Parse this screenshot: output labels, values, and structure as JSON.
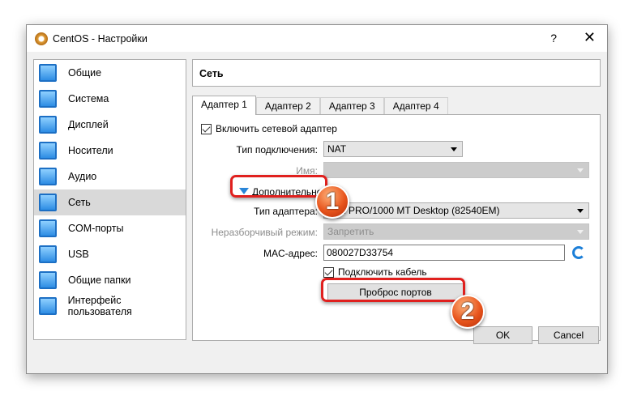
{
  "window": {
    "title": "CentOS - Настройки",
    "help": "?",
    "close": "✕"
  },
  "sidebar": {
    "items": [
      {
        "label": "Общие",
        "icon": "general-icon"
      },
      {
        "label": "Система",
        "icon": "system-icon"
      },
      {
        "label": "Дисплей",
        "icon": "display-icon"
      },
      {
        "label": "Носители",
        "icon": "storage-icon"
      },
      {
        "label": "Аудио",
        "icon": "audio-icon"
      },
      {
        "label": "Сеть",
        "icon": "network-icon"
      },
      {
        "label": "COM-порты",
        "icon": "serial-ports-icon"
      },
      {
        "label": "USB",
        "icon": "usb-icon"
      },
      {
        "label": "Общие папки",
        "icon": "shared-folders-icon"
      },
      {
        "label": "Интерфейс пользователя",
        "icon": "user-interface-icon"
      }
    ],
    "active": "Сеть"
  },
  "header": {
    "title": "Сеть"
  },
  "tabs": [
    "Адаптер 1",
    "Адаптер 2",
    "Адаптер 3",
    "Адаптер 4"
  ],
  "form": {
    "enable_adapter": "Включить сетевой адаптер",
    "attached_to_label": "Тип подключения:",
    "attached_to_value": "NAT",
    "name_label": "Имя:",
    "advanced": "Дополнительно",
    "adapter_type_label": "Тип адаптера:",
    "adapter_type_value": "Intel PRO/1000 MT Desktop (82540EM)",
    "promisc_label": "Неразборчивый режим:",
    "promisc_value": "Запретить",
    "mac_label": "MAC-адрес:",
    "mac_value": "080027D33754",
    "cable": "Подключить кабель",
    "port_forwarding": "Проброс портов"
  },
  "buttons": {
    "ok": "OK",
    "cancel": "Cancel"
  },
  "annotations": {
    "step1": "1",
    "step2": "2"
  },
  "colors": {
    "highlight": "#e0201e",
    "badge": "#e8551d"
  }
}
